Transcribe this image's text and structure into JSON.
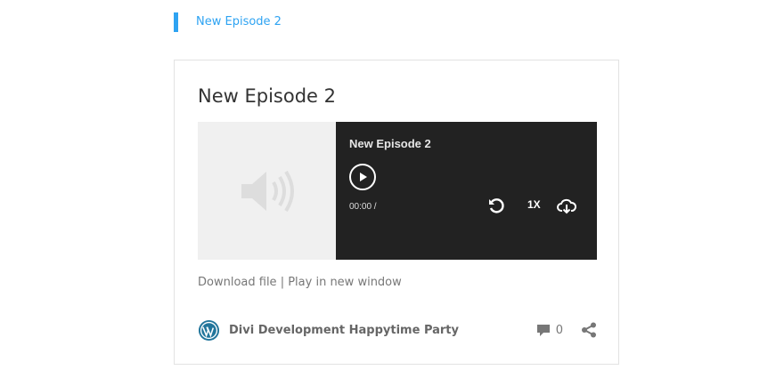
{
  "breadcrumb": {
    "label": "New Episode 2"
  },
  "episode": {
    "title": "New Episode 2",
    "player_title": "New Episode 2",
    "time": "00:00 /",
    "speed": "1X",
    "icons": {
      "artwork": "speaker-icon",
      "play": "play-icon",
      "replay": "replay-icon",
      "download": "cloud-download-icon"
    }
  },
  "links": {
    "download": "Download file",
    "separator": " | ",
    "play_new": "Play in new window"
  },
  "footer": {
    "author": "Divi Development Happytime Party",
    "comments": "0"
  },
  "colors": {
    "accent": "#2ea3f2",
    "player_bg": "#222222",
    "wp_blue": "#21759b"
  }
}
